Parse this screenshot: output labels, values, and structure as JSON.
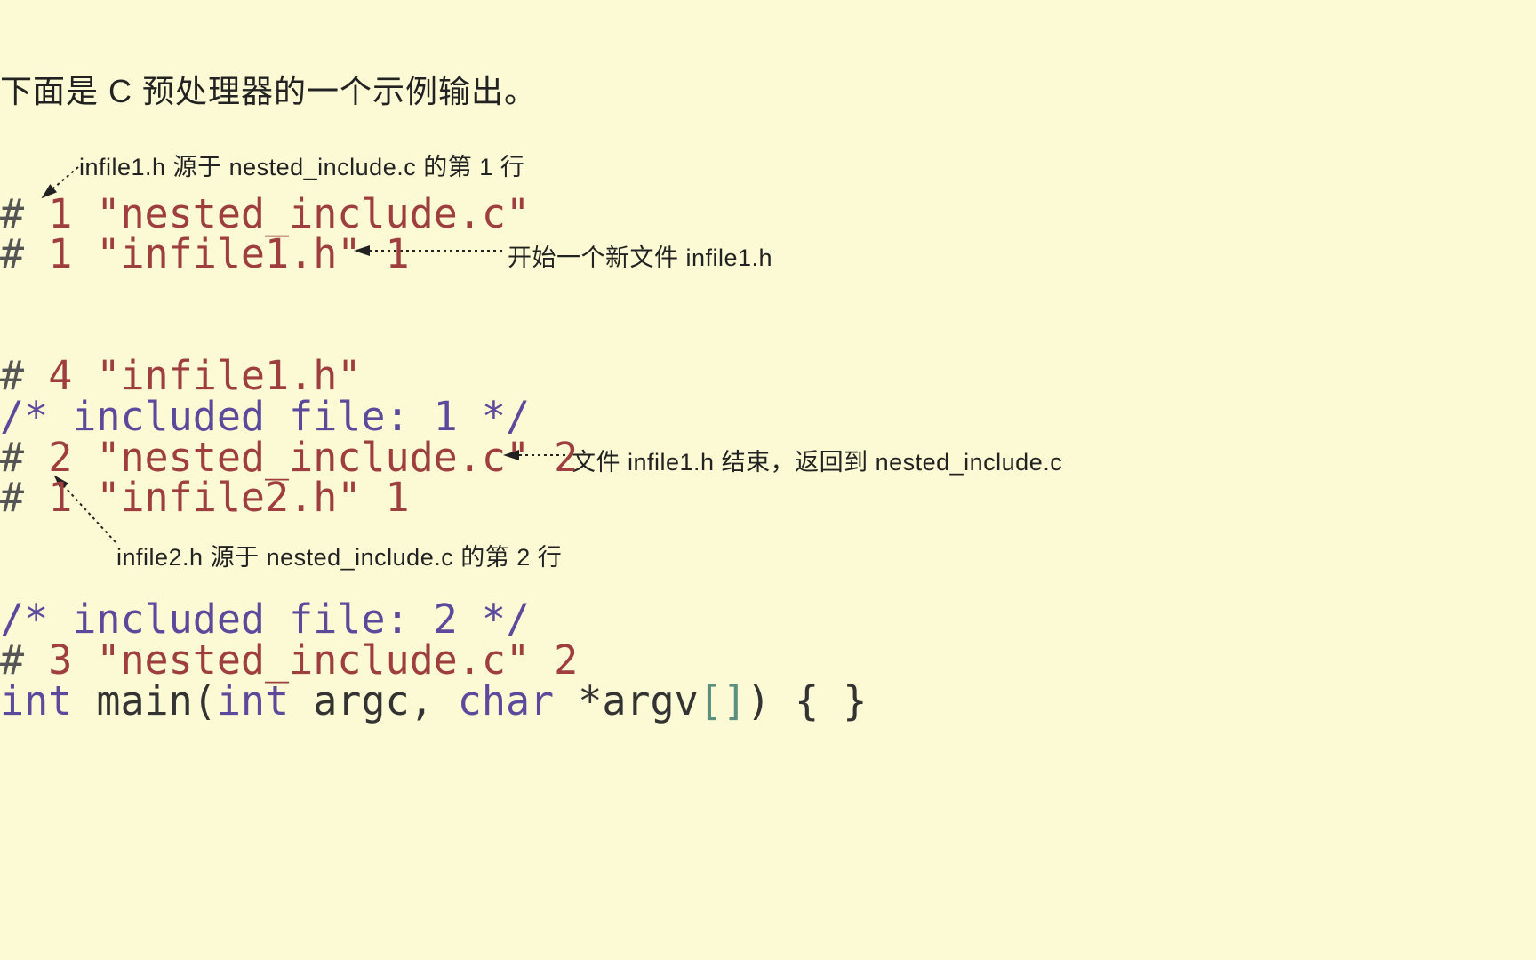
{
  "intro": "下面是 C 预处理器的一个示例输出。",
  "annotations": {
    "a1": "infile1.h 源于 nested_include.c 的第 1 行",
    "a2": "开始一个新文件 infile1.h",
    "a3": "文件 infile1.h 结束，返回到 nested_include.c",
    "a4": "infile2.h 源于 nested_include.c 的第 2 行"
  },
  "code": {
    "l1": {
      "hash": "#",
      "num": "1",
      "str": "\"nested_include.c\""
    },
    "l2": {
      "hash": "#",
      "num": "1",
      "str": "\"infile1.h\"",
      "flag": "1"
    },
    "l3": {
      "hash": "#",
      "num": "4",
      "str": "\"infile1.h\""
    },
    "l4": {
      "comment": "/* included file: 1 */"
    },
    "l5": {
      "hash": "#",
      "num": "2",
      "str": "\"nested_include.c\"",
      "flag": "2"
    },
    "l6": {
      "hash": "#",
      "num": "1",
      "str": "\"infile2.h\"",
      "flag": "1"
    },
    "l7": {
      "comment": "/* included file: 2 */"
    },
    "l8": {
      "hash": "#",
      "num": "3",
      "str": "\"nested_include.c\"",
      "flag": "2"
    },
    "l9": {
      "kw_int": "int",
      "sp1": " ",
      "main": "main",
      "lp": "(",
      "kw_int2": "int",
      "sp2": " ",
      "argc": "argc",
      "comma": ", ",
      "kw_char": "char",
      "sp3": " ",
      "star": "*",
      "argv": "argv",
      "lb": "[",
      "rb": "]",
      "rp": ")",
      "sp4": " ",
      "lbrace": "{ }",
      "sp5": ""
    }
  }
}
